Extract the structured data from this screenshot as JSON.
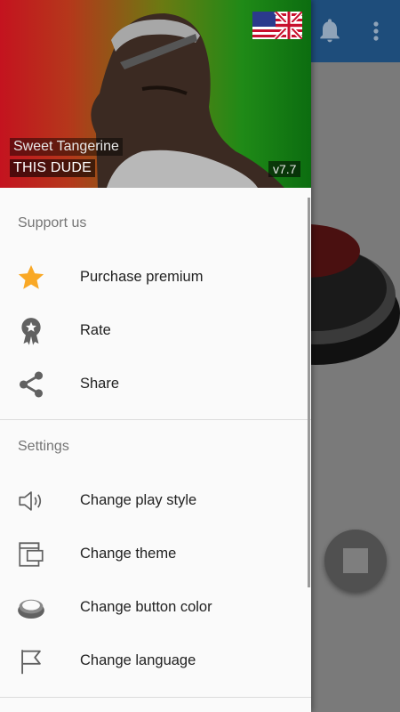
{
  "header": {
    "subtitle": "Sweet Tangerine",
    "title": "THIS DUDE",
    "version": "v7.7",
    "flag_icon": "uk-us-flag-icon"
  },
  "support": {
    "section_title": "Support us",
    "items": [
      {
        "label": "Purchase premium",
        "icon": "star-icon",
        "icon_color": "#f9a825"
      },
      {
        "label": "Rate",
        "icon": "award-badge-icon",
        "icon_color": "#616161"
      },
      {
        "label": "Share",
        "icon": "share-icon",
        "icon_color": "#616161"
      }
    ]
  },
  "settings": {
    "section_title": "Settings",
    "items": [
      {
        "label": "Change play style",
        "icon": "speaker-icon"
      },
      {
        "label": "Change theme",
        "icon": "theme-icon"
      },
      {
        "label": "Change button color",
        "icon": "button-color-icon"
      },
      {
        "label": "Change language",
        "icon": "flag-icon"
      }
    ]
  },
  "background_app": {
    "toolbar_color": "#1e4d7b",
    "icons": [
      "bell-icon",
      "more-vert-icon",
      "stop-icon"
    ]
  }
}
